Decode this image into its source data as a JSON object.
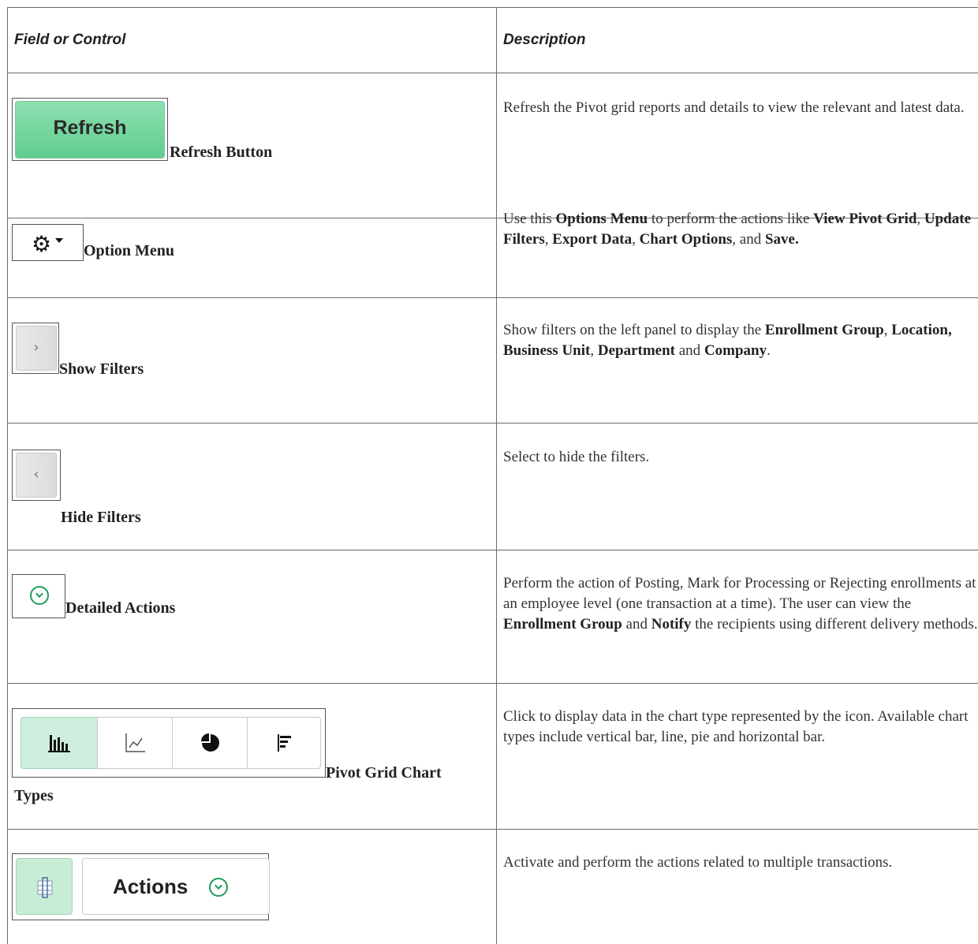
{
  "headers": {
    "field": "Field or Control",
    "description": "Description"
  },
  "rows": [
    {
      "button_text": "Refresh",
      "label": "Refresh Button",
      "description": "Refresh the Pivot grid reports and details to view the relevant and latest data."
    },
    {
      "label": "Option Menu",
      "desc": {
        "p1": "Use this ",
        "b1": "Options Menu",
        "p2": " to perform the actions like ",
        "b2": "View Pivot Grid",
        "p3": ", ",
        "b3": "Update Filters",
        "p4": ", ",
        "b4": "Export Data",
        "p5": ", ",
        "b5": "Chart Options",
        "p6": ", and ",
        "b6": "Save."
      }
    },
    {
      "label": "Show Filters",
      "desc": {
        "p1": "Show filters on the left panel to display the ",
        "b1": "Enrollment Group",
        "p2": ", ",
        "b2": "Location, Business Unit",
        "p3": ", ",
        "b3": "Department",
        "p4": " and ",
        "b4": "Company",
        "p5": "."
      }
    },
    {
      "label": "Hide Filters",
      "description": "Select to hide the filters."
    },
    {
      "label": "Detailed Actions",
      "desc": {
        "p1": "Perform the action of Posting, Mark for Processing or Rejecting enrollments at an employee level (one transaction at a time). The user can view the ",
        "b1": "Enrollment Group",
        "p2": " and ",
        "b2": "Notify",
        "p3": " the recipients using different delivery methods."
      }
    },
    {
      "label_line1": "Pivot Grid Chart",
      "label_line2": "Types",
      "description": "Click to display data in the chart type represented by the icon. Available chart types include vertical bar, line, pie and horizontal bar."
    },
    {
      "actions_text": "Actions",
      "description": "Activate and perform the actions related to multiple transactions."
    }
  ],
  "icons": [
    "gear-icon",
    "chevron-right-icon",
    "chevron-left-icon",
    "circle-chevron-down-icon",
    "vertical-bar-chart-icon",
    "line-chart-icon",
    "pie-chart-icon",
    "horizontal-bar-chart-icon",
    "grid-select-icon"
  ],
  "colors": {
    "accent_green": "#1f9c5a",
    "button_green": "#6fd49b",
    "selected_bg": "#cfeedd",
    "rule": "#6b6b6b"
  }
}
